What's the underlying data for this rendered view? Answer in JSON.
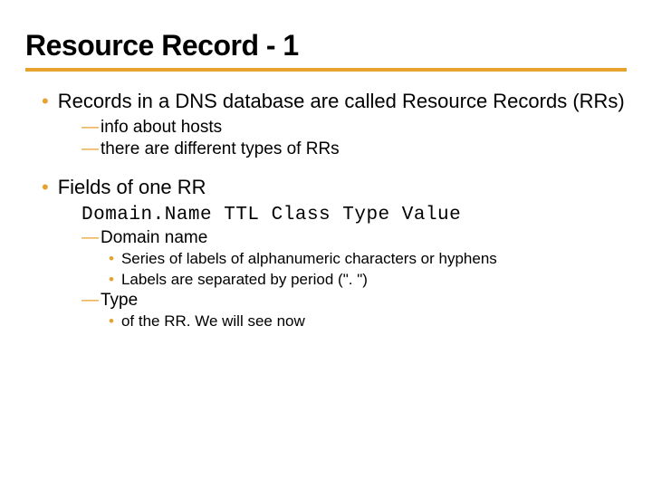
{
  "title": "Resource Record - 1",
  "items": [
    {
      "text": "Records in a DNS database are called Resource Records (RRs)",
      "subs": [
        {
          "text": "info about hosts"
        },
        {
          "text": "there are different types of RRs"
        }
      ]
    },
    {
      "text": "Fields of one RR",
      "mono": "Domain.Name TTL Class Type Value",
      "subs": [
        {
          "text": "Domain name",
          "subs": [
            {
              "text": "Series of labels of alphanumeric characters or hyphens"
            },
            {
              "text": "Labels are separated by period (\". \")"
            }
          ]
        },
        {
          "text": "Type",
          "subs": [
            {
              "text": "of the RR. We will see now"
            }
          ]
        }
      ]
    }
  ]
}
